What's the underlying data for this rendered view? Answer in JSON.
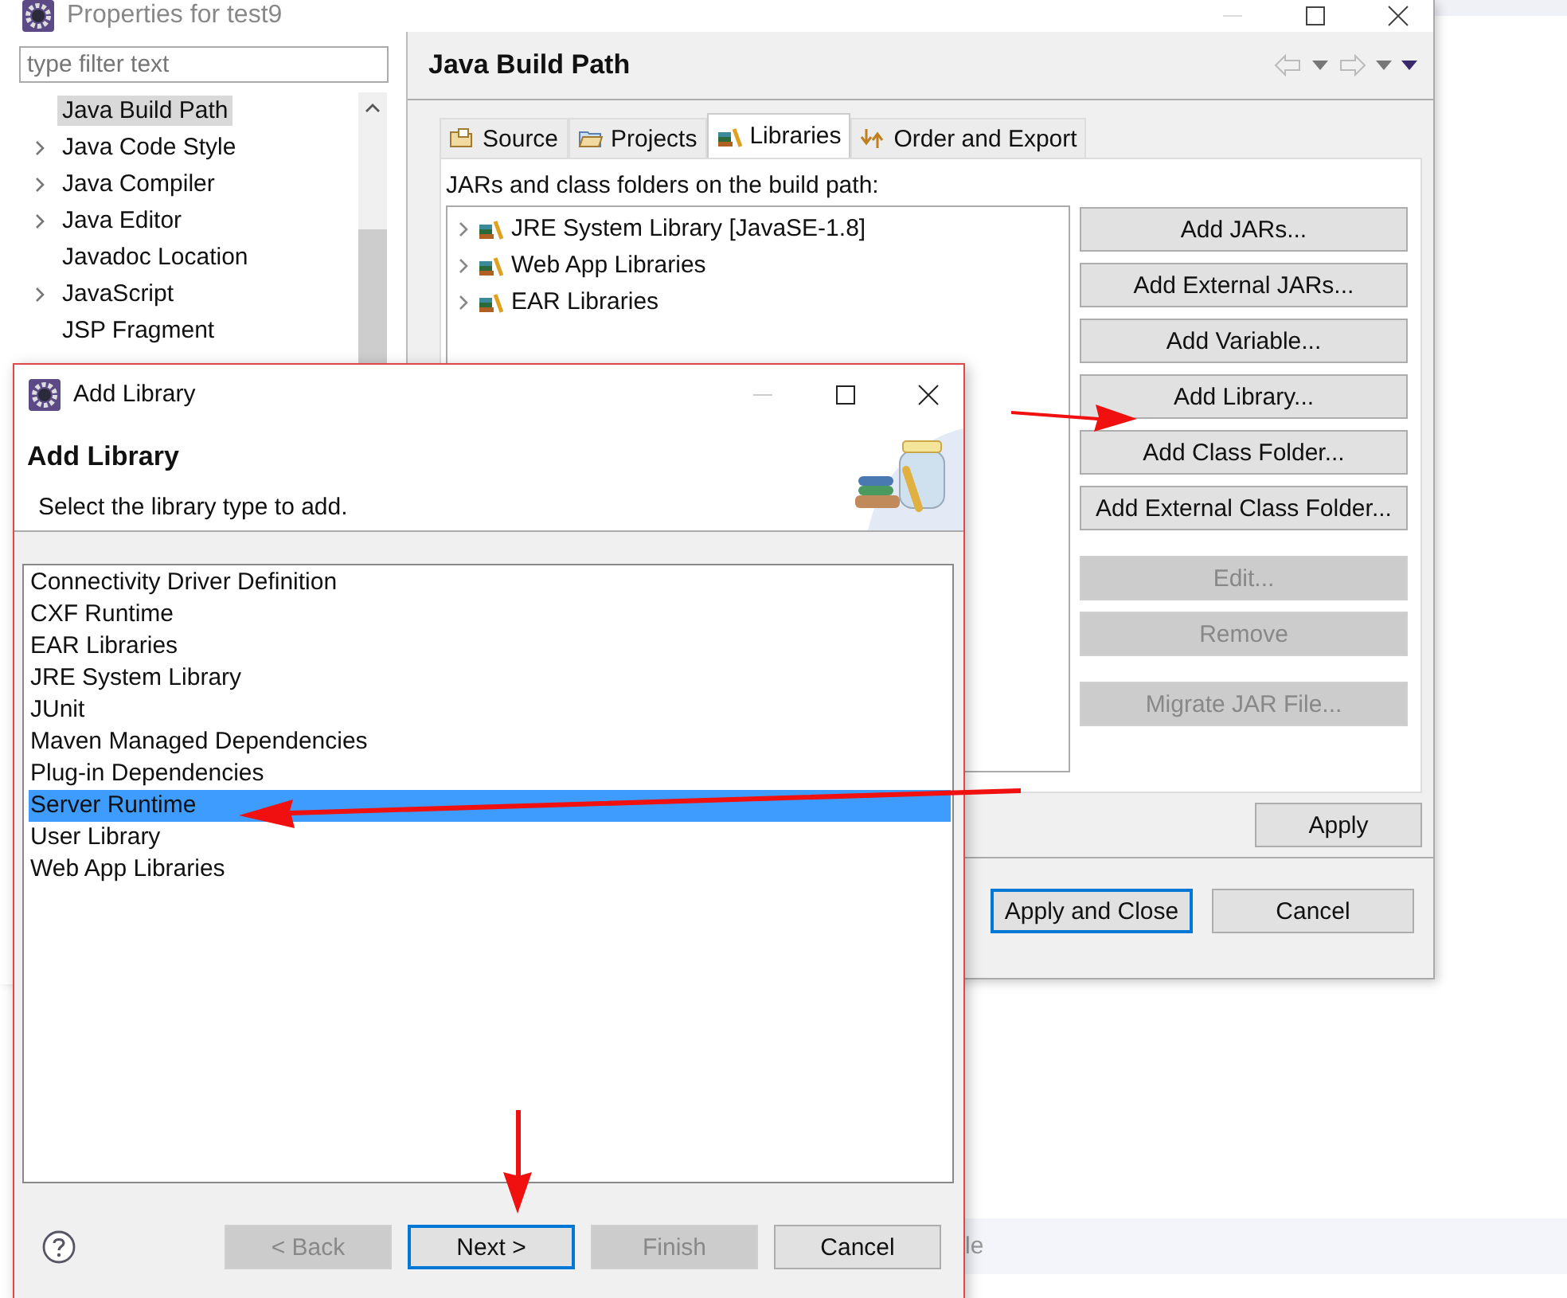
{
  "main_window": {
    "title": "Properties for test9",
    "filter": {
      "placeholder": "type filter text"
    },
    "nav_items": [
      {
        "label": "Java Build Path",
        "expandable": false,
        "selected": true
      },
      {
        "label": "Java Code Style",
        "expandable": true,
        "selected": false
      },
      {
        "label": "Java Compiler",
        "expandable": true,
        "selected": false
      },
      {
        "label": "Java Editor",
        "expandable": true,
        "selected": false
      },
      {
        "label": "Javadoc Location",
        "expandable": false,
        "selected": false
      },
      {
        "label": "JavaScript",
        "expandable": true,
        "selected": false
      },
      {
        "label": "JSP Fragment",
        "expandable": false,
        "selected": false
      }
    ],
    "page_title": "Java Build Path",
    "tabs": [
      {
        "label": "Source",
        "kind": "source",
        "selected": false
      },
      {
        "label": "Projects",
        "kind": "projects",
        "selected": false
      },
      {
        "label": "Libraries",
        "kind": "libraries",
        "selected": true
      },
      {
        "label": "Order and Export",
        "kind": "order",
        "selected": false
      }
    ],
    "libraries_caption": "JARs and class folders on the build path:",
    "libraries": [
      {
        "label": "JRE System Library [JavaSE-1.8]"
      },
      {
        "label": "Web App Libraries"
      },
      {
        "label": "EAR Libraries"
      }
    ],
    "side_button_groups": [
      [
        {
          "label": "Add JARs...",
          "disabled": false
        },
        {
          "label": "Add External JARs...",
          "disabled": false
        },
        {
          "label": "Add Variable...",
          "disabled": false
        },
        {
          "label": "Add Library...",
          "disabled": false
        },
        {
          "label": "Add Class Folder...",
          "disabled": false
        },
        {
          "label": "Add External Class Folder...",
          "disabled": false
        }
      ],
      [
        {
          "label": "Edit...",
          "disabled": true
        },
        {
          "label": "Remove",
          "disabled": true
        }
      ],
      [
        {
          "label": "Migrate JAR File...",
          "disabled": true
        }
      ]
    ],
    "apply": "Apply",
    "footer_buttons": [
      {
        "label": "Apply and Close",
        "default": true
      },
      {
        "label": "Cancel",
        "default": false
      }
    ]
  },
  "dialog": {
    "title": "Add Library",
    "heading": "Add Library",
    "description": "Select the library type to add.",
    "library_types": [
      {
        "label": "Connectivity Driver Definition",
        "selected": false
      },
      {
        "label": "CXF Runtime",
        "selected": false
      },
      {
        "label": "EAR Libraries",
        "selected": false
      },
      {
        "label": "JRE System Library",
        "selected": false
      },
      {
        "label": "JUnit",
        "selected": false
      },
      {
        "label": "Maven Managed Dependencies",
        "selected": false
      },
      {
        "label": "Plug-in Dependencies",
        "selected": false
      },
      {
        "label": "Server Runtime",
        "selected": true
      },
      {
        "label": "User Library",
        "selected": false
      },
      {
        "label": "Web App Libraries",
        "selected": false
      }
    ],
    "buttons": [
      {
        "label": "< Back",
        "disabled": true,
        "default": false
      },
      {
        "label": "Next >",
        "disabled": false,
        "default": true
      },
      {
        "label": "Finish",
        "disabled": true,
        "default": false
      },
      {
        "label": "Cancel",
        "disabled": false,
        "default": false
      }
    ]
  },
  "background_text": "le"
}
